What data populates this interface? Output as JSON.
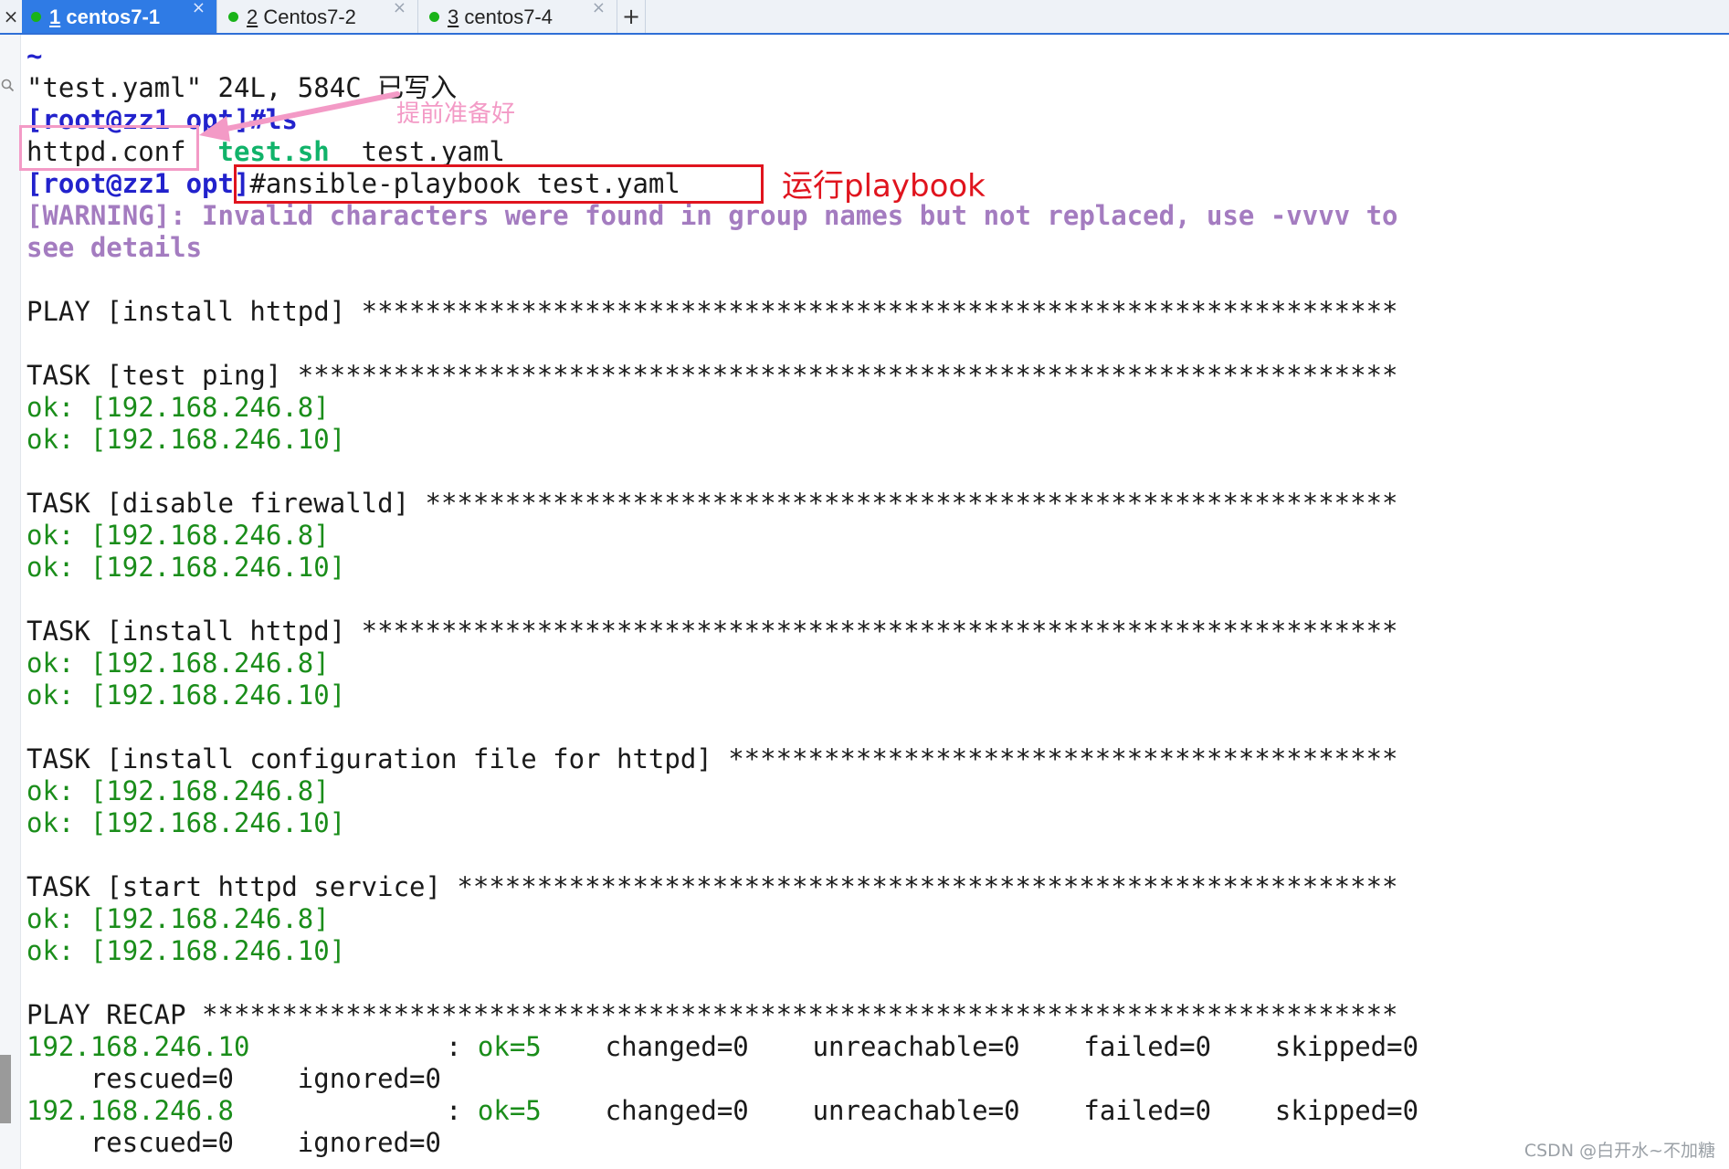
{
  "tabs": [
    {
      "num": "1",
      "label": "centos7-1",
      "active": true
    },
    {
      "num": "2",
      "label": "Centos7-2",
      "active": false
    },
    {
      "num": "3",
      "label": "centos7-4",
      "active": false
    }
  ],
  "tab_close": "×",
  "tab_add": "+",
  "tab_x_left": "×",
  "terminal": {
    "l0": "~",
    "l1": "\"test.yaml\" 24L, 584C 已写入",
    "l2": "[root@zz1 opt]#ls",
    "l3_file1": "httpd.conf",
    "l3_file2": "test.sh",
    "l3_file3": "test.yaml",
    "l4_prompt": "[root@zz1 opt]",
    "l4_cmd": "#ansible-playbook test.yaml",
    "l5": "[WARNING]: Invalid characters were found in group names but not replaced, use -vvvv to",
    "l6": "see details",
    "play": "PLAY [install httpd] *****************************************************************",
    "task1": "TASK [test ping] *********************************************************************",
    "task1_ok1": "ok: [192.168.246.8]",
    "task1_ok2": "ok: [192.168.246.10]",
    "task2": "TASK [disable firewalld] *************************************************************",
    "task2_ok1": "ok: [192.168.246.8]",
    "task2_ok2": "ok: [192.168.246.10]",
    "task3": "TASK [install httpd] *****************************************************************",
    "task3_ok1": "ok: [192.168.246.8]",
    "task3_ok2": "ok: [192.168.246.10]",
    "task4": "TASK [install configuration file for httpd] ******************************************",
    "task4_ok1": "ok: [192.168.246.8]",
    "task4_ok2": "ok: [192.168.246.10]",
    "task5": "TASK [start httpd service] ***********************************************************",
    "task5_ok1": "ok: [192.168.246.8]",
    "task5_ok2": "ok: [192.168.246.10]",
    "recap": "PLAY RECAP ***************************************************************************",
    "recap_rows": [
      {
        "host": "192.168.246.10",
        "sep": ": ",
        "ok": "ok=5",
        "stats": "    changed=0    unreachable=0    failed=0    skipped=0",
        "cont": "    rescued=0    ignored=0"
      },
      {
        "host": "192.168.246.8",
        "sep": ": ",
        "ok": "ok=5",
        "stats": "    changed=0    unreachable=0    failed=0    skipped=0",
        "cont": "    rescued=0    ignored=0"
      }
    ]
  },
  "annotations": {
    "prepared_label": "提前准备好",
    "run_label": "运行playbook"
  },
  "watermark": "CSDN @白开水~不加糖",
  "colors": {
    "accent_tab": "#2f7be5",
    "ok_green": "#1a8d1a",
    "prompt_blue": "#2222cc",
    "warning_purple": "#a47cc0",
    "annotation_pink": "#f39ac6",
    "annotation_red": "#e0141e"
  }
}
